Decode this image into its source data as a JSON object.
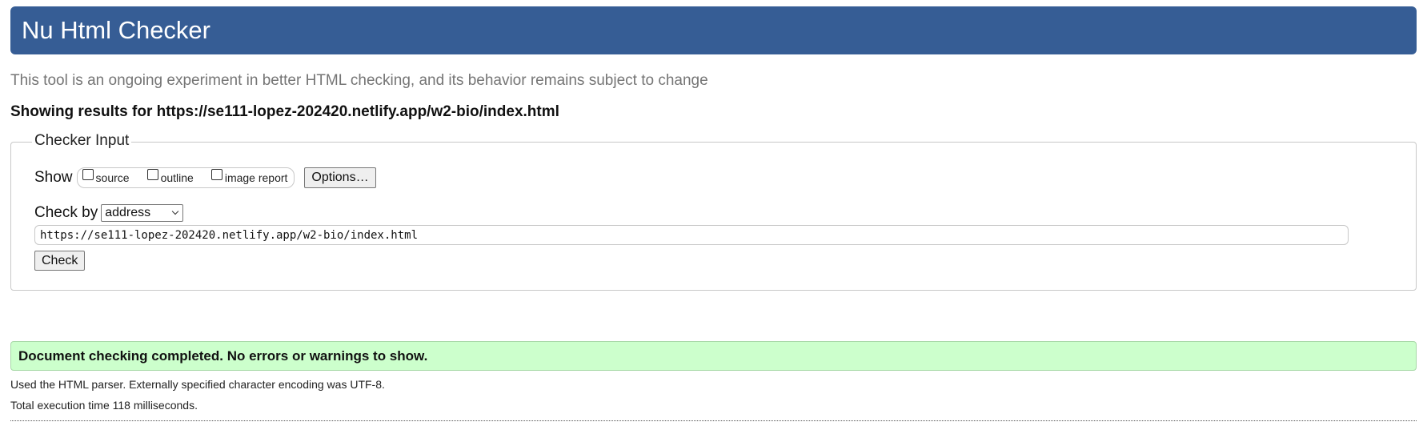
{
  "header": {
    "title": "Nu Html Checker"
  },
  "subtitle": "This tool is an ongoing experiment in better HTML checking, and its behavior remains subject to change",
  "results_heading": "Showing results for https://se111-lopez-202420.netlify.app/w2-bio/index.html",
  "checker_input": {
    "legend": "Checker Input",
    "show_label": "Show",
    "show_options": [
      {
        "label": "source",
        "checked": false
      },
      {
        "label": "outline",
        "checked": false
      },
      {
        "label": "image report",
        "checked": false
      }
    ],
    "options_button": "Options…",
    "check_by_label": "Check by",
    "check_by_selected": "address",
    "address_value": "https://se111-lopez-202420.netlify.app/w2-bio/index.html",
    "check_button": "Check"
  },
  "result": {
    "message": "Document checking completed. No errors or warnings to show.",
    "parser_info": "Used the HTML parser. Externally specified character encoding was UTF-8.",
    "execution_time": "Total execution time 118 milliseconds."
  },
  "colors": {
    "header_bg": "#365d95",
    "success_bg": "#ccffcc"
  }
}
